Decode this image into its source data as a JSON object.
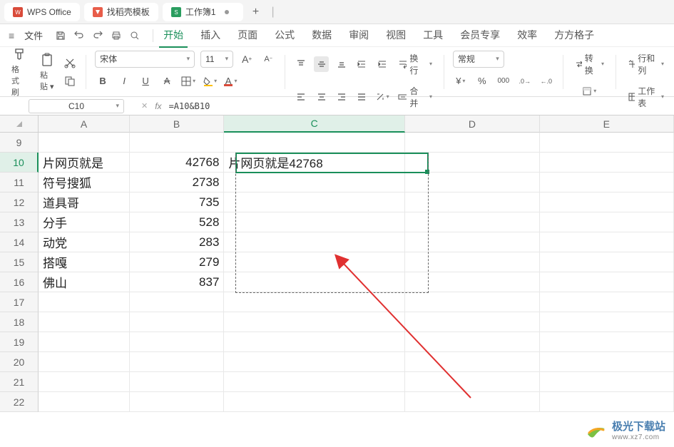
{
  "tabs": {
    "app": "WPS Office",
    "template": "找稻壳模板",
    "workbook": "工作簿1"
  },
  "menu": {
    "file": "文件",
    "items": [
      "开始",
      "插入",
      "页面",
      "公式",
      "数据",
      "审阅",
      "视图",
      "工具",
      "会员专享",
      "效率",
      "方方格子"
    ],
    "active": "开始"
  },
  "ribbon": {
    "format_painter": "格式刷",
    "paste": "粘贴",
    "font_name": "宋体",
    "font_size": "11",
    "wrap": "换行",
    "merge": "合并",
    "general": "常规",
    "convert": "转换",
    "rows_cols": "行和列",
    "worksheet": "工作表"
  },
  "formula_bar": {
    "name_box": "C10",
    "formula": "=A10&B10"
  },
  "columns": [
    "A",
    "B",
    "C",
    "D",
    "E"
  ],
  "rows": [
    "9",
    "10",
    "11",
    "12",
    "13",
    "14",
    "15",
    "16",
    "17",
    "18",
    "19",
    "20",
    "21",
    "22"
  ],
  "selected_col": "C",
  "selected_row": "10",
  "data": {
    "r10": {
      "a": "片网页就是",
      "b": "42768",
      "c": "片网页就是42768"
    },
    "r11": {
      "a": "符号搜狐",
      "b": "2738"
    },
    "r12": {
      "a": "道具哥",
      "b": "735"
    },
    "r13": {
      "a": "分手",
      "b": "528"
    },
    "r14": {
      "a": "动党",
      "b": "283"
    },
    "r15": {
      "a": "搭嘎",
      "b": "279"
    },
    "r16": {
      "a": "佛山",
      "b": "837"
    }
  },
  "chart_data": {
    "type": "table",
    "columns": [
      "A",
      "B",
      "C"
    ],
    "rows": [
      {
        "A": "片网页就是",
        "B": 42768,
        "C": "片网页就是42768"
      },
      {
        "A": "符号搜狐",
        "B": 2738,
        "C": null
      },
      {
        "A": "道具哥",
        "B": 735,
        "C": null
      },
      {
        "A": "分手",
        "B": 528,
        "C": null
      },
      {
        "A": "动党",
        "B": 283,
        "C": null
      },
      {
        "A": "搭嘎",
        "B": 279,
        "C": null
      },
      {
        "A": "佛山",
        "B": 837,
        "C": null
      }
    ]
  },
  "watermark": {
    "cn": "极光下载站",
    "en": "www.xz7.com"
  }
}
